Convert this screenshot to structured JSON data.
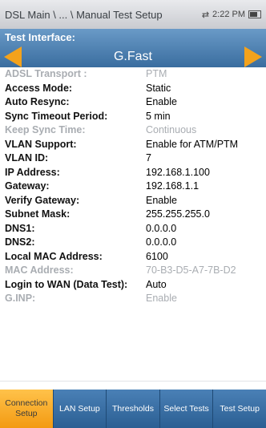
{
  "status_bar": {
    "breadcrumb": "DSL Main \\ ... \\ Manual Test Setup",
    "time": "2:22 PM",
    "icons": [
      "network-arrows-icon",
      "battery-icon"
    ]
  },
  "interface": {
    "label": "Test Interface:",
    "value": "G.Fast",
    "prev_icon": "left-arrow-icon",
    "next_icon": "right-arrow-icon"
  },
  "settings": [
    {
      "label": "ADSL Transport :",
      "value": "PTM",
      "enabled": false
    },
    {
      "label": "Access Mode:",
      "value": "Static",
      "enabled": true
    },
    {
      "label": "Auto Resync:",
      "value": "Enable",
      "enabled": true
    },
    {
      "label": "Sync Timeout Period:",
      "value": "5 min",
      "enabled": true
    },
    {
      "label": "Keep Sync Time:",
      "value": "Continuous",
      "enabled": false
    },
    {
      "label": "VLAN Support:",
      "value": "Enable for ATM/PTM",
      "enabled": true
    },
    {
      "label": "VLAN ID:",
      "value": "7",
      "enabled": true
    },
    {
      "label": "IP Address:",
      "value": "192.168.1.100",
      "enabled": true
    },
    {
      "label": "Gateway:",
      "value": "192.168.1.1",
      "enabled": true
    },
    {
      "label": "Verify Gateway:",
      "value": "Enable",
      "enabled": true
    },
    {
      "label": "Subnet Mask:",
      "value": "255.255.255.0",
      "enabled": true
    },
    {
      "label": "DNS1:",
      "value": "0.0.0.0",
      "enabled": true
    },
    {
      "label": "DNS2:",
      "value": "0.0.0.0",
      "enabled": true
    },
    {
      "label": "Local MAC Address:",
      "value": "6100",
      "enabled": true
    },
    {
      "label": "MAC Address:",
      "value": "70-B3-D5-A7-7B-D2",
      "enabled": false
    },
    {
      "label": "Login to WAN (Data Test):",
      "value": "Auto",
      "enabled": true
    },
    {
      "label": "G.INP:",
      "value": "Enable",
      "enabled": false
    }
  ],
  "tabs": [
    {
      "label": "Connection Setup",
      "active": true
    },
    {
      "label": "LAN Setup",
      "active": false
    },
    {
      "label": "Thresholds",
      "active": false
    },
    {
      "label": "Select Tests",
      "active": false
    },
    {
      "label": "Test Setup",
      "active": false
    }
  ],
  "colors": {
    "accent": "#f3a21c",
    "panel_blue": "#4a7fb5",
    "disabled_text": "#a9adb2"
  }
}
